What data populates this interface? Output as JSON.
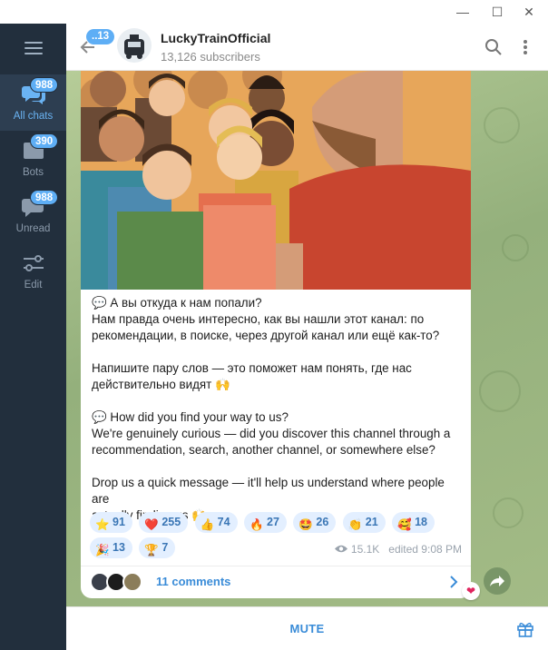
{
  "window": {
    "minimize": "—",
    "maximize": "☐",
    "close": "✕"
  },
  "rail": {
    "folders": [
      {
        "label": "All chats",
        "badge": "988",
        "icon": "chats-icon"
      },
      {
        "label": "Bots",
        "badge": "390",
        "icon": "folder-icon"
      },
      {
        "label": "Unread",
        "badge": "988",
        "icon": "chat-bubble-icon"
      },
      {
        "label": "Edit",
        "badge": "",
        "icon": "sliders-icon"
      }
    ]
  },
  "header": {
    "back_badge": "..13",
    "title": "LuckyTrainOfficial",
    "subtitle": "13,126 subscribers"
  },
  "post": {
    "paragraphs_ru": [
      "💬 А вы откуда к нам попали?",
      "Нам правда очень интересно, как вы нашли этот канал: по",
      "рекомендации, в поиске, через другой канал или ещё как-то?",
      "Напишите пару слов — это поможет нам понять, где нас",
      "действительно видят 🙌"
    ],
    "paragraphs_en": [
      "💬 How did you find your way to us?",
      "We're genuinely curious — did you discover this channel through a",
      "recommendation, search, another channel, or somewhere else?",
      "Drop us a quick message — it'll help us understand where people are",
      "actually finding us 🙌"
    ],
    "reactions": [
      {
        "emoji": "⭐",
        "count": "91"
      },
      {
        "emoji": "❤️",
        "count": "255"
      },
      {
        "emoji": "👍",
        "count": "74"
      },
      {
        "emoji": "🔥",
        "count": "27"
      },
      {
        "emoji": "🤩",
        "count": "26"
      },
      {
        "emoji": "👏",
        "count": "21"
      },
      {
        "emoji": "🥰",
        "count": "18"
      },
      {
        "emoji": "🎉",
        "count": "13"
      },
      {
        "emoji": "🏆",
        "count": "7"
      }
    ],
    "views": "15.1K",
    "edited": "edited 9:08 PM",
    "comments": "11 comments"
  },
  "bottom": {
    "mute_label": "MUTE"
  },
  "colors": {
    "accent": "#3a8cd8",
    "rail": "#222f3d",
    "badge": "#5eaef5"
  }
}
